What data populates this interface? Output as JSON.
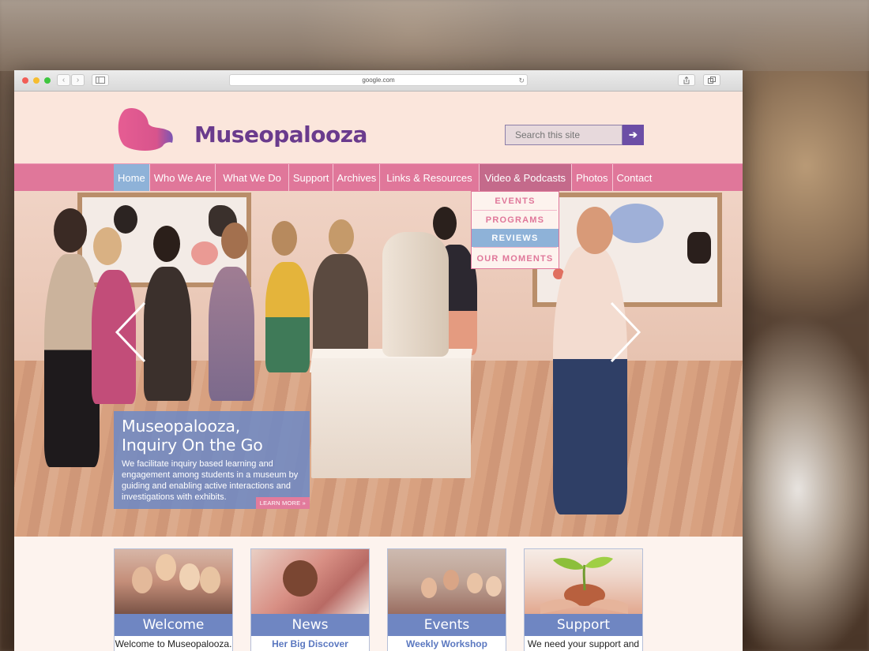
{
  "browser": {
    "url": "google.com",
    "back_label": "‹",
    "forward_label": "›"
  },
  "site": {
    "brand": "Museopalooza",
    "search_placeholder": "Search this site",
    "search_button": "➔",
    "colors": {
      "nav_bg": "#e0779a",
      "nav_active": "#8eb2d8",
      "brand_purple": "#6a3b8d",
      "caption_blue": "#708ac4"
    }
  },
  "nav": {
    "items": [
      {
        "label": "Home"
      },
      {
        "label": "Who We Are"
      },
      {
        "label": "What We Do"
      },
      {
        "label": "Support"
      },
      {
        "label": "Archives"
      },
      {
        "label": "Links & Resources"
      },
      {
        "label": "Video & Podcasts"
      },
      {
        "label": "Photos"
      },
      {
        "label": "Contact"
      }
    ],
    "dropdown": [
      {
        "label": "EVENTS"
      },
      {
        "label": "PROGRAMS"
      },
      {
        "label": "REVIEWS"
      },
      {
        "label": "OUR MOMENTS"
      }
    ]
  },
  "hero": {
    "title_line1": "Museopalooza,",
    "title_line2": "Inquiry On the Go",
    "body": "We facilitate inquiry based learning and engagement among students in a museum by guiding and enabling active interactions and investigations with exhibits.",
    "learn_more": "LEARN MORE »"
  },
  "cards": [
    {
      "title": "Welcome",
      "subtitle": "Welcome to Museopalooza."
    },
    {
      "title": "News",
      "subtitle": "Her Big Discover"
    },
    {
      "title": "Events",
      "subtitle": "Weekly Workshop"
    },
    {
      "title": "Support",
      "subtitle": "We need your support and"
    }
  ]
}
